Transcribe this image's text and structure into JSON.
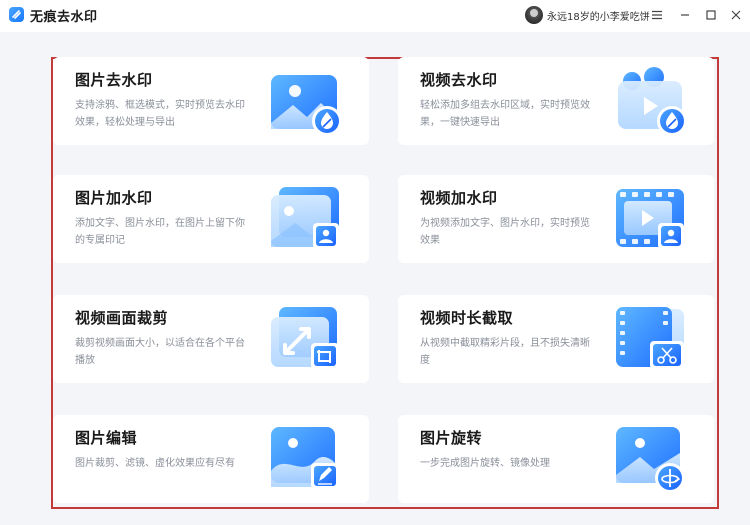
{
  "app": {
    "title": "无痕去水印",
    "logo_icon": "app-logo-icon",
    "accent": "#1677ff"
  },
  "user": {
    "name": "永远18岁的小李爱吃饼",
    "avatar_icon": "avatar"
  },
  "window_controls": [
    "menu-icon",
    "minimize-icon",
    "maximize-icon",
    "close-icon"
  ],
  "cards": [
    {
      "title": "图片去水印",
      "desc": "支持涂鸦、框选模式，实时预览去水印效果，轻松处理与导出",
      "icon": "image-remove-watermark-icon"
    },
    {
      "title": "视频去水印",
      "desc": "轻松添加多组去水印区域，实时预览效果，一键快速导出",
      "icon": "video-remove-watermark-icon"
    },
    {
      "title": "图片加水印",
      "desc": "添加文字、图片水印，在图片上留下你的专属印记",
      "icon": "image-add-watermark-icon"
    },
    {
      "title": "视频加水印",
      "desc": "为视频添加文字、图片水印，实时预览效果",
      "icon": "video-add-watermark-icon"
    },
    {
      "title": "视频画面裁剪",
      "desc": "裁剪视频画面大小，以适合在各个平台播放",
      "icon": "video-crop-icon"
    },
    {
      "title": "视频时长截取",
      "desc": "从视频中截取精彩片段，且不损失清晰度",
      "icon": "video-trim-icon"
    },
    {
      "title": "图片编辑",
      "desc": "图片裁剪、滤镜、虚化效果应有尽有",
      "icon": "image-edit-icon"
    },
    {
      "title": "图片旋转",
      "desc": "一步完成图片旋转、镜像处理",
      "icon": "image-rotate-icon"
    }
  ],
  "highlight_frame_color": "#c23a3a"
}
